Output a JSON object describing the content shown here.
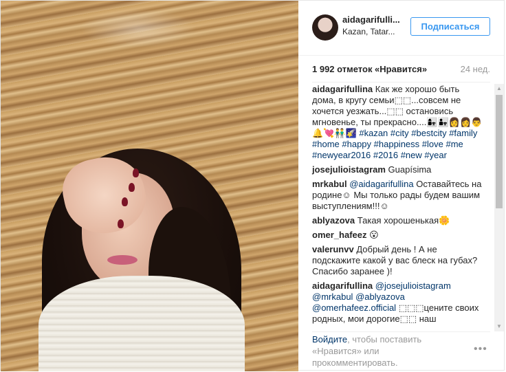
{
  "header": {
    "username": "aidagarifulli...",
    "location": "Kazan, Tatar...",
    "follow_label": "Подписаться"
  },
  "stats": {
    "likes": "1 992 отметок «Нравится»",
    "time": "24 нед."
  },
  "comments": [
    {
      "user": "aidagarifullina",
      "parts": [
        {
          "t": "text",
          "v": " Как же хорошо быть дома, в кругу семьи⬚⬚...совсем не хочется уезжать...⬚⬚ остановись мгновенье, ты прекрасно....👩‍👧👨‍👧👩‍👩👨 🔔💘👬🌠 "
        },
        {
          "t": "tag",
          "v": "#kazan"
        },
        {
          "t": "text",
          "v": " "
        },
        {
          "t": "tag",
          "v": "#city"
        },
        {
          "t": "text",
          "v": " "
        },
        {
          "t": "tag",
          "v": "#bestcity"
        },
        {
          "t": "text",
          "v": " "
        },
        {
          "t": "tag",
          "v": "#family"
        },
        {
          "t": "text",
          "v": " "
        },
        {
          "t": "tag",
          "v": "#home"
        },
        {
          "t": "text",
          "v": " "
        },
        {
          "t": "tag",
          "v": "#happy"
        },
        {
          "t": "text",
          "v": " "
        },
        {
          "t": "tag",
          "v": "#happiness"
        },
        {
          "t": "text",
          "v": " "
        },
        {
          "t": "tag",
          "v": "#love"
        },
        {
          "t": "text",
          "v": " "
        },
        {
          "t": "tag",
          "v": "#me"
        },
        {
          "t": "text",
          "v": " "
        },
        {
          "t": "tag",
          "v": "#newyear2016"
        },
        {
          "t": "text",
          "v": " "
        },
        {
          "t": "tag",
          "v": "#2016"
        },
        {
          "t": "text",
          "v": " "
        },
        {
          "t": "tag",
          "v": "#new"
        },
        {
          "t": "text",
          "v": " "
        },
        {
          "t": "tag",
          "v": "#year"
        }
      ]
    },
    {
      "user": "josejulioistagram",
      "parts": [
        {
          "t": "text",
          "v": " Guapísima"
        }
      ]
    },
    {
      "user": "mrkabul",
      "parts": [
        {
          "t": "text",
          "v": " "
        },
        {
          "t": "mention",
          "v": "@aidagarifullina"
        },
        {
          "t": "text",
          "v": " Оставайтесь на родине☺ Мы только рады будем вашим выступлениям!!!☺"
        }
      ]
    },
    {
      "user": "ablyazova",
      "parts": [
        {
          "t": "text",
          "v": " Такая хорошенькая🌼"
        }
      ]
    },
    {
      "user": "omer_hafeez",
      "parts": [
        {
          "t": "text",
          "v": " 😮"
        }
      ]
    },
    {
      "user": "valerunvv",
      "parts": [
        {
          "t": "text",
          "v": " Добрый день ! А не подскажите какой у вас блеск на губах? Спасибо заранее )!"
        }
      ]
    },
    {
      "user": "aidagarifullina",
      "parts": [
        {
          "t": "text",
          "v": " "
        },
        {
          "t": "mention",
          "v": "@josejulioistagram"
        },
        {
          "t": "text",
          "v": " "
        },
        {
          "t": "mention",
          "v": "@mrkabul"
        },
        {
          "t": "text",
          "v": " "
        },
        {
          "t": "mention",
          "v": "@ablyazova"
        },
        {
          "t": "text",
          "v": " "
        },
        {
          "t": "mention",
          "v": "@omerhafeez.official"
        },
        {
          "t": "text",
          "v": " ⬚⬚⬚цените своих родных, мои дорогие⬚⬚ наш"
        }
      ]
    }
  ],
  "footer": {
    "login_link": "Войдите",
    "rest": ", чтобы поставить «Нравится» или прокомментировать.",
    "more_symbol": "•••"
  },
  "icons": {
    "scroll_up": "▲",
    "scroll_down": "▼"
  },
  "colors": {
    "accent": "#3897f0",
    "link": "#003569",
    "muted": "#999999"
  }
}
